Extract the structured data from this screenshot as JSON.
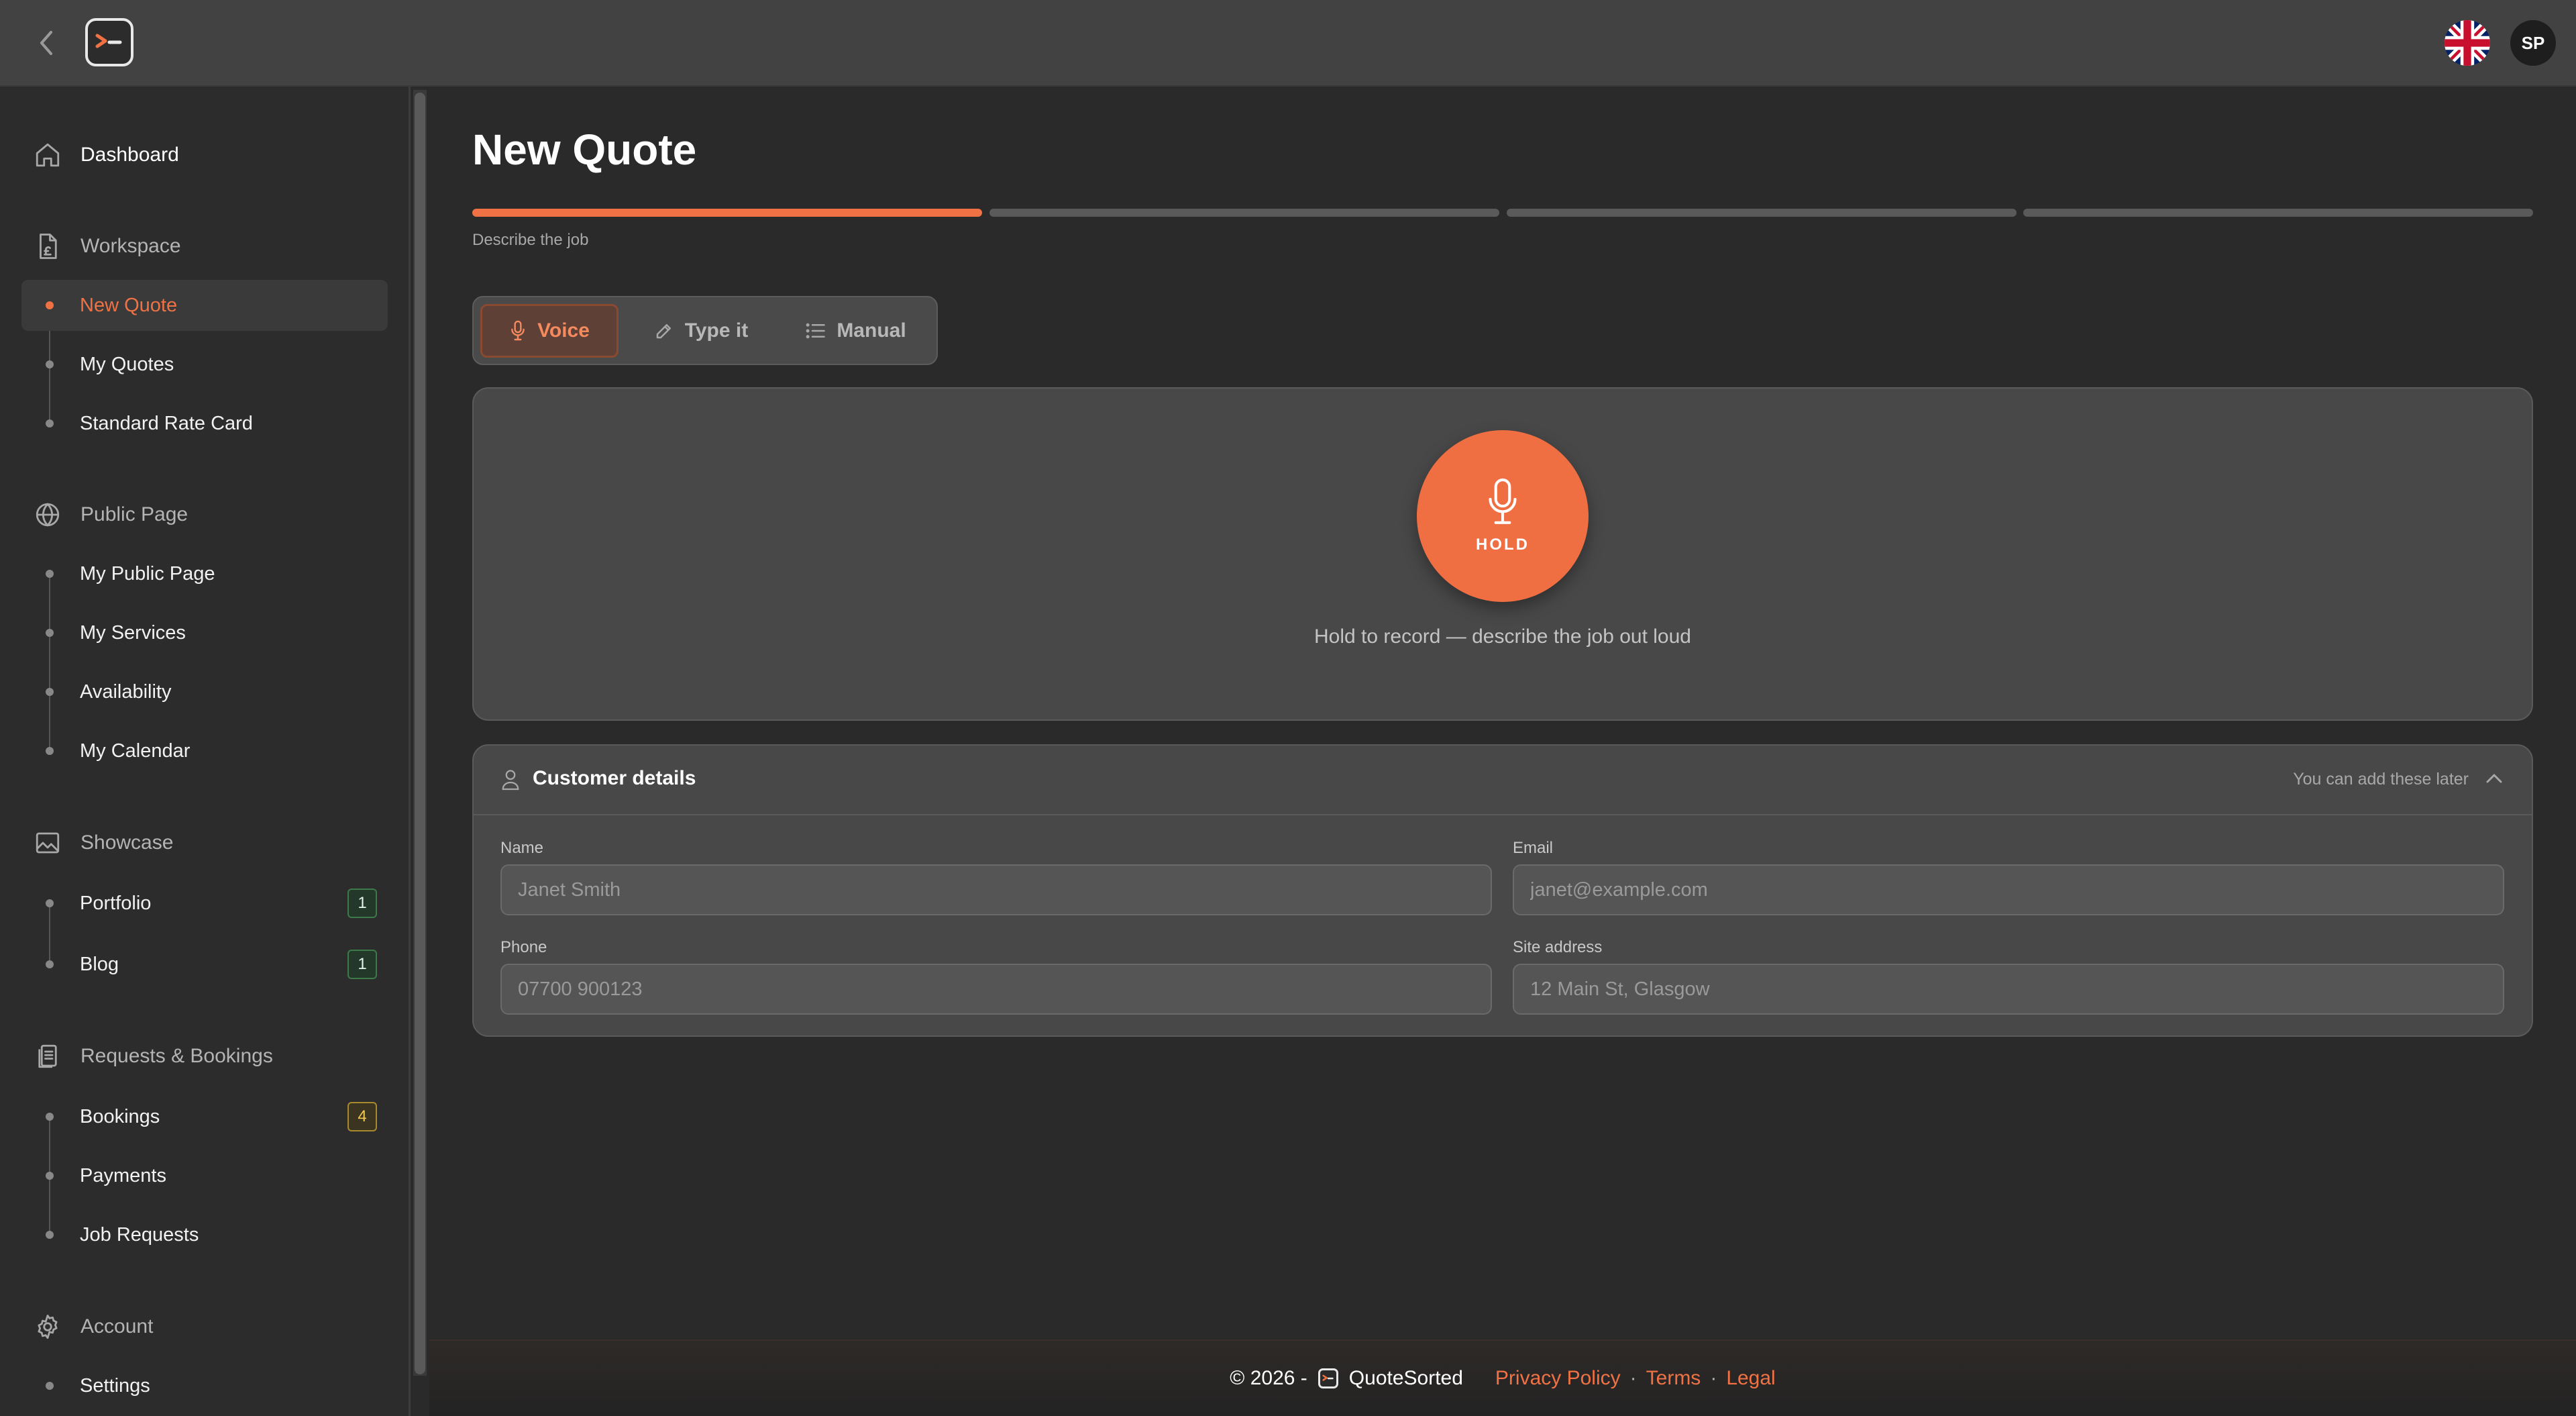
{
  "header": {
    "back_icon": "chevron-left-icon",
    "logo_icon": "terminal-prompt-logo",
    "language_flag": "uk-flag-icon",
    "avatar_initials": "SP"
  },
  "sidebar": {
    "dashboard": {
      "label": "Dashboard",
      "icon": "home-icon"
    },
    "sections": [
      {
        "label": "Workspace",
        "icon": "document-pound-icon",
        "items": [
          {
            "label": "New Quote",
            "active": true
          },
          {
            "label": "My Quotes"
          },
          {
            "label": "Standard Rate Card"
          }
        ]
      },
      {
        "label": "Public Page",
        "icon": "globe-icon",
        "items": [
          {
            "label": "My Public Page"
          },
          {
            "label": "My Services"
          },
          {
            "label": "Availability"
          },
          {
            "label": "My Calendar"
          }
        ]
      },
      {
        "label": "Showcase",
        "icon": "image-icon",
        "items": [
          {
            "label": "Portfolio",
            "badge": "1"
          },
          {
            "label": "Blog",
            "badge": "1"
          }
        ]
      },
      {
        "label": "Requests & Bookings",
        "icon": "clipboard-icon",
        "items": [
          {
            "label": "Bookings",
            "badge": "4"
          },
          {
            "label": "Payments"
          },
          {
            "label": "Job Requests"
          }
        ]
      },
      {
        "label": "Account",
        "icon": "gear-icon",
        "items": [
          {
            "label": "Settings"
          }
        ]
      }
    ]
  },
  "main": {
    "title": "New Quote",
    "progress": {
      "current_step": 1,
      "total_steps": 4,
      "caption": "Describe the job"
    },
    "modes": [
      {
        "label": "Voice",
        "icon": "microphone-icon",
        "active": true
      },
      {
        "label": "Type it",
        "icon": "pencil-icon"
      },
      {
        "label": "Manual",
        "icon": "list-icon"
      }
    ],
    "voice": {
      "button_label": "HOLD",
      "hint": "Hold to record — describe the job out loud"
    },
    "customer": {
      "title": "Customer details",
      "note": "You can add these later",
      "fields": {
        "name": {
          "label": "Name",
          "placeholder": "Janet Smith"
        },
        "email": {
          "label": "Email",
          "placeholder": "janet@example.com"
        },
        "phone": {
          "label": "Phone",
          "placeholder": "07700 900123"
        },
        "address": {
          "label": "Site address",
          "placeholder": "12 Main St, Glasgow"
        }
      }
    }
  },
  "footer": {
    "copyright": "© 2026 -",
    "brand": "QuoteSorted",
    "links": [
      "Privacy Policy",
      "Terms",
      "Legal"
    ],
    "separator": "·"
  },
  "colors": {
    "accent": "#f07244",
    "background": "#2a2a2a",
    "badge_amber": "#f0c850"
  }
}
